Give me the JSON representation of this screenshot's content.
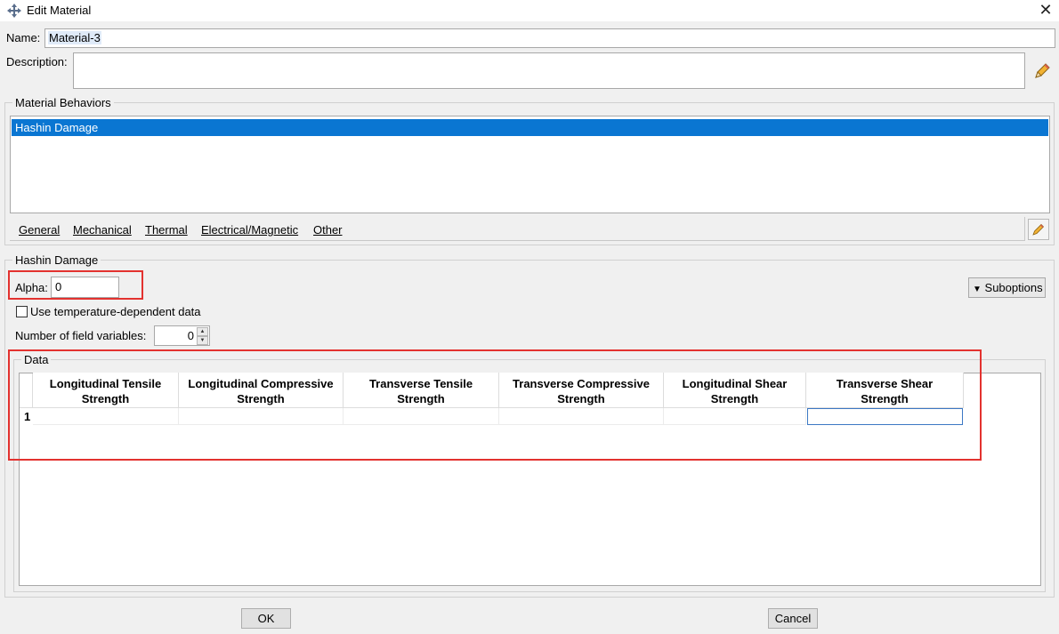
{
  "window": {
    "title": "Edit Material",
    "app_icon": "abaqus-cross-icon",
    "close_icon": "close-icon",
    "close_glyph": "✕"
  },
  "name": {
    "label": "Name:",
    "value": "Material-3"
  },
  "description": {
    "label": "Description:",
    "value": ""
  },
  "behaviors": {
    "title": "Material Behaviors",
    "items": [
      "Hashin Damage"
    ],
    "selected_index": 0,
    "menu": [
      "General",
      "Mechanical",
      "Thermal",
      "Electrical/Magnetic",
      "Other"
    ]
  },
  "hashin": {
    "title": "Hashin Damage",
    "alpha_label": "Alpha:",
    "alpha_value": "0",
    "suboptions_label": "Suboptions",
    "temp_dependent_label": "Use temperature-dependent data",
    "temp_dependent_checked": false,
    "field_vars_label": "Number of field variables:",
    "field_vars_value": "0"
  },
  "data_table": {
    "title": "Data",
    "columns": [
      [
        "Longitudinal Tensile",
        "Strength"
      ],
      [
        "Longitudinal Compressive",
        "Strength"
      ],
      [
        "Transverse Tensile",
        "Strength"
      ],
      [
        "Transverse Compressive",
        "Strength"
      ],
      [
        "Longitudinal Shear",
        "Strength"
      ],
      [
        "Transverse Shear",
        "Strength"
      ]
    ],
    "rows": [
      {
        "index": "1",
        "values": [
          "",
          "",
          "",
          "",
          "",
          ""
        ]
      }
    ]
  },
  "footer": {
    "ok_label": "OK",
    "cancel_label": "Cancel"
  },
  "colors": {
    "selection": "#0a76d2",
    "highlight_box": "#e3322f",
    "window_bg": "#f0f0f0"
  }
}
